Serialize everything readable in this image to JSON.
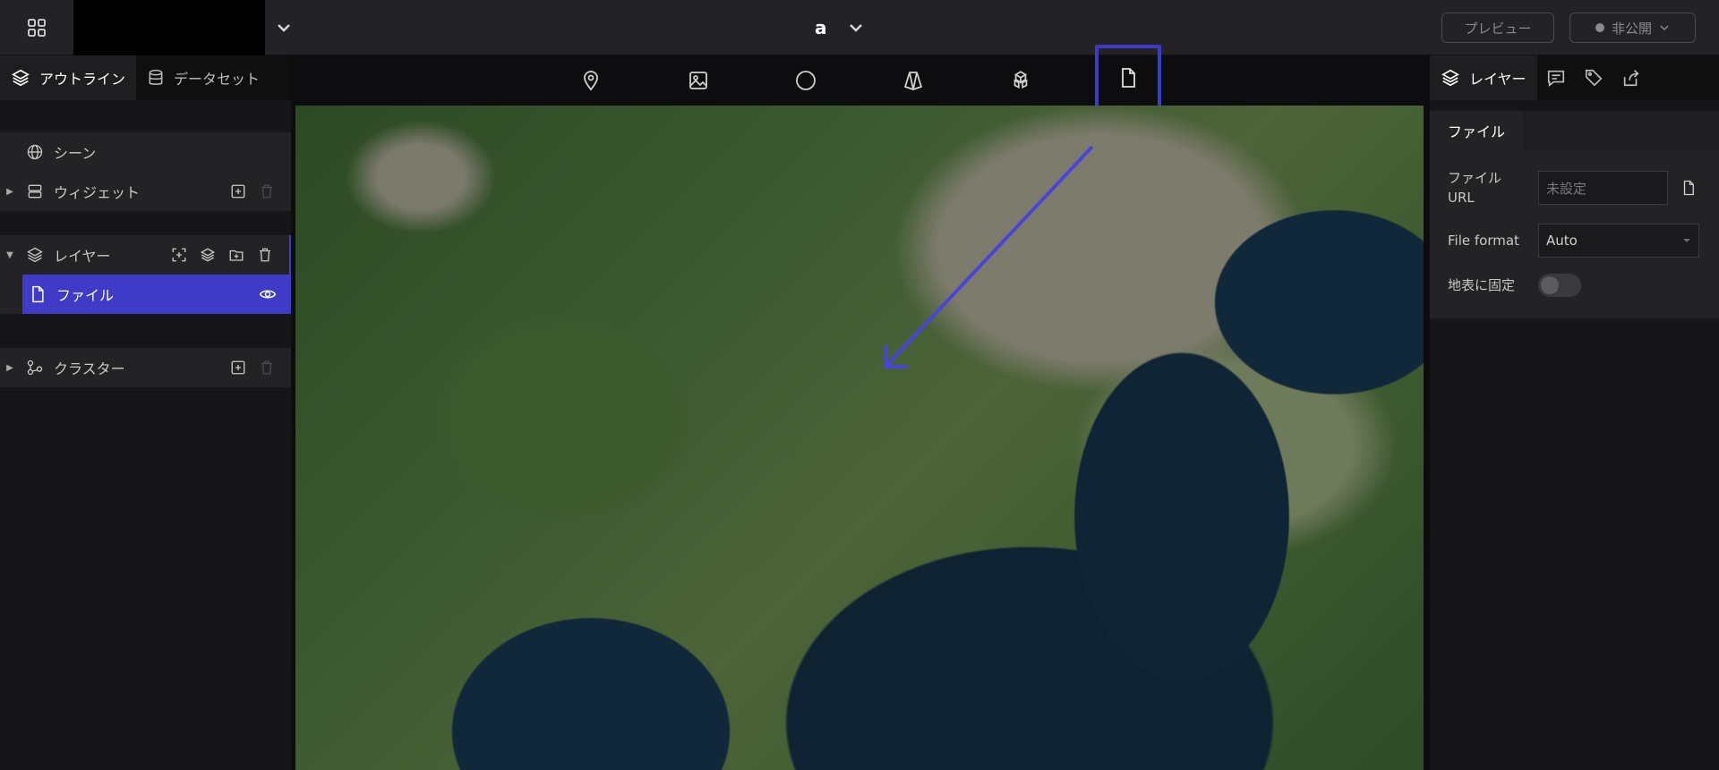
{
  "topbar": {
    "scene_title": "a",
    "preview_label": "プレビュー",
    "publish_label": "非公開"
  },
  "left_panel": {
    "tabs": [
      {
        "label": "アウトライン",
        "icon": "layers-icon"
      },
      {
        "label": "データセット",
        "icon": "database-icon"
      }
    ],
    "scene_label": "シーン",
    "widget_label": "ウィジェット",
    "layer_label": "レイヤー",
    "file_label": "ファイル",
    "cluster_label": "クラスター"
  },
  "toolbar": {
    "tools": [
      "marker-icon",
      "image-icon",
      "circle-icon",
      "polygon-icon",
      "model-icon",
      "file-icon"
    ],
    "selected_tool": "file-icon"
  },
  "right_panel": {
    "tabs": [
      {
        "label": "レイヤー",
        "icon": "layers-icon"
      },
      {
        "label": "",
        "icon": "comment-icon"
      },
      {
        "label": "",
        "icon": "tag-icon"
      },
      {
        "label": "",
        "icon": "export-icon"
      }
    ],
    "section_tab": "ファイル",
    "file_url_label": "ファイル\nURL",
    "file_url_placeholder": "未設定",
    "file_format_label": "File format",
    "file_format_value": "Auto",
    "clamp_label": "地表に固定"
  },
  "colors": {
    "accent": "#3f3bc7",
    "topbar_bg": "#232226",
    "panel_bg": "#161618"
  }
}
